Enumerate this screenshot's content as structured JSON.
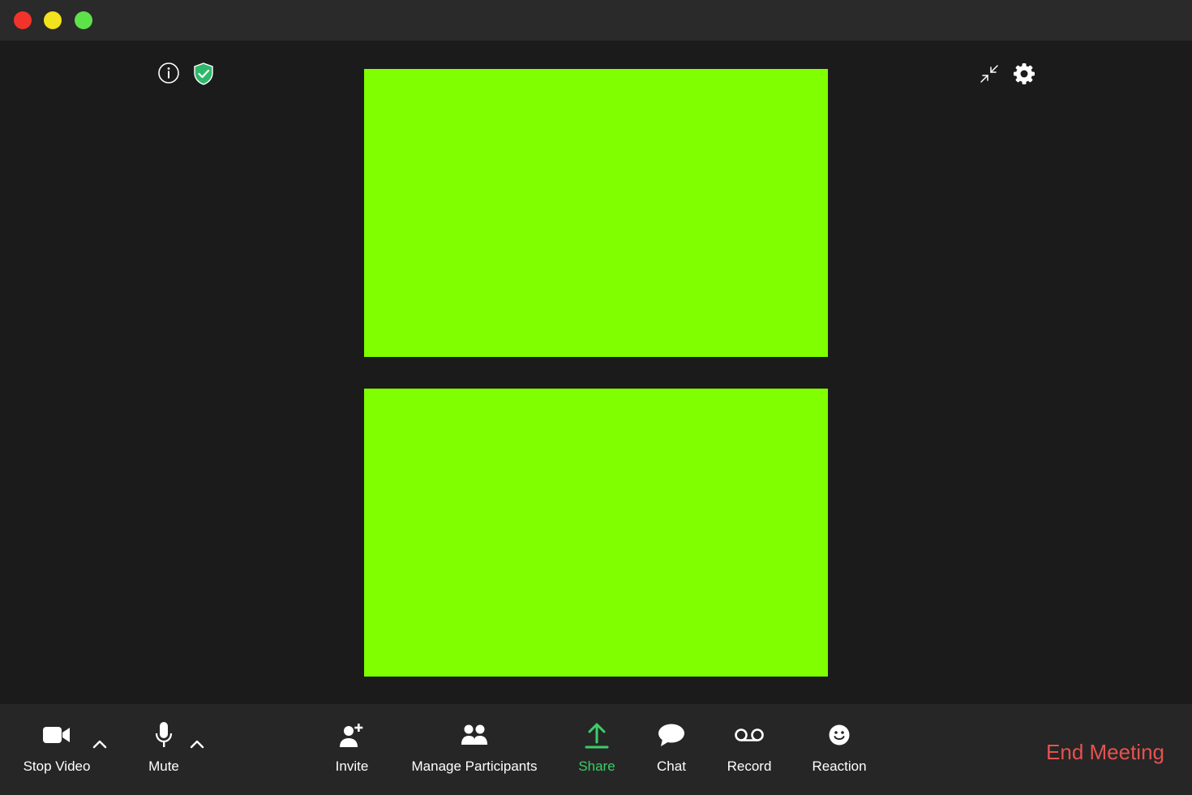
{
  "window": {
    "traffic_lights": {
      "close": {
        "color": "#f2332b",
        "icon": "close-icon"
      },
      "minimize": {
        "color": "#f3e21e",
        "icon": "minimize-icon"
      },
      "maximize": {
        "color": "#5ee24a",
        "icon": "maximize-icon"
      }
    }
  },
  "stage": {
    "top_left_icons": [
      "info-icon",
      "shield-check-icon"
    ],
    "top_right_icons": [
      "exit-fullscreen-icon",
      "gear-icon"
    ],
    "video_tiles": [
      {
        "color": "#80ff00"
      },
      {
        "color": "#80ff00"
      }
    ]
  },
  "toolbar": {
    "stop_video": {
      "label": "Stop Video",
      "icon": "video-camera-icon"
    },
    "mute": {
      "label": "Mute",
      "icon": "microphone-icon"
    },
    "invite": {
      "label": "Invite",
      "icon": "add-user-icon"
    },
    "manage_participants": {
      "label": "Manage Participants",
      "icon": "participants-icon"
    },
    "share": {
      "label": "Share",
      "icon": "share-upload-icon",
      "color": "#3ccd6a"
    },
    "chat": {
      "label": "Chat",
      "icon": "chat-bubble-icon"
    },
    "record": {
      "label": "Record",
      "icon": "record-icon"
    },
    "reaction": {
      "label": "Reaction",
      "icon": "smiley-icon"
    },
    "end_meeting": {
      "label": "End Meeting",
      "color": "#e5524f"
    }
  }
}
